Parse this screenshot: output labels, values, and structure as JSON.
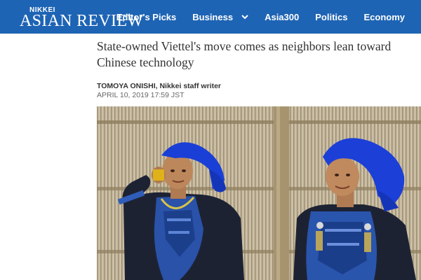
{
  "header": {
    "logo_top": "NIKKEI",
    "logo_main": "ASIAN REVIEW",
    "nav": [
      {
        "label": "Editor's Picks"
      },
      {
        "label": "Business"
      },
      {
        "label": "Asia300"
      },
      {
        "label": "Politics"
      },
      {
        "label": "Economy"
      }
    ]
  },
  "article": {
    "headline": "State-owned Viettel's move comes as neighbors lean toward Chinese technology",
    "author": "TOMOYA ONISHI, Nikkei staff writer",
    "date": "APRIL 10, 2019 17:59 JST"
  },
  "colors": {
    "brand_blue": "#1e64b4"
  }
}
